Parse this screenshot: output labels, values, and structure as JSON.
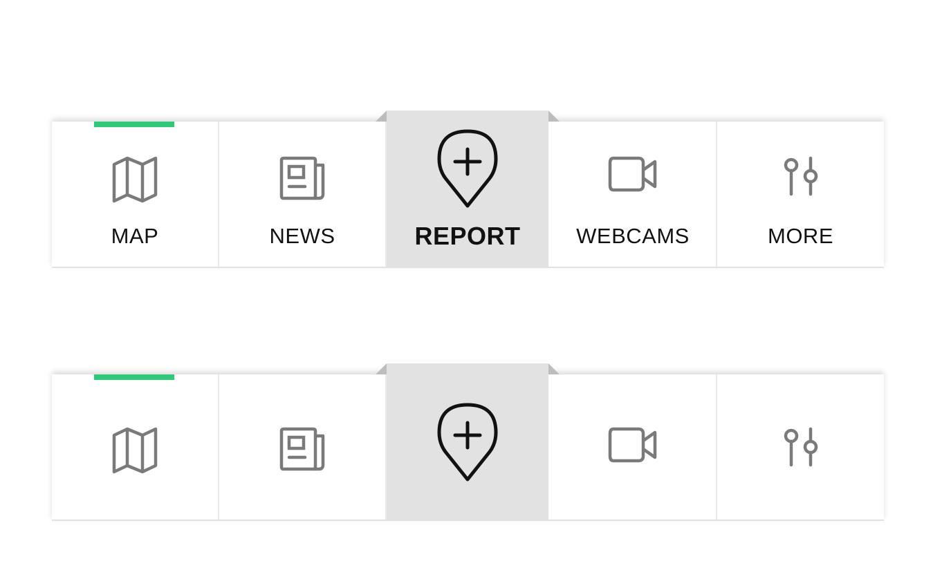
{
  "navbar_labeled": {
    "tabs": [
      {
        "id": "map",
        "label": "MAP",
        "icon": "map-icon",
        "active": true
      },
      {
        "id": "news",
        "label": "NEWS",
        "icon": "newspaper-icon",
        "active": false
      },
      {
        "id": "report",
        "label": "REPORT",
        "icon": "location-plus-icon",
        "active": false
      },
      {
        "id": "webcams",
        "label": "WEBCAMS",
        "icon": "video-camera-icon",
        "active": false
      },
      {
        "id": "more",
        "label": "MORE",
        "icon": "sliders-icon",
        "active": false
      }
    ]
  },
  "navbar_icons_only": {
    "tabs": [
      {
        "id": "map",
        "icon": "map-icon",
        "active": true
      },
      {
        "id": "news",
        "icon": "newspaper-icon",
        "active": false
      },
      {
        "id": "report",
        "icon": "location-plus-icon",
        "active": false
      },
      {
        "id": "webcams",
        "icon": "video-camera-icon",
        "active": false
      },
      {
        "id": "more",
        "icon": "sliders-icon",
        "active": false
      }
    ]
  },
  "colors": {
    "active_indicator": "#2fc97a",
    "report_background": "#e2e2e2",
    "icon_gray": "#7a7a7a",
    "icon_dark": "#111111"
  }
}
